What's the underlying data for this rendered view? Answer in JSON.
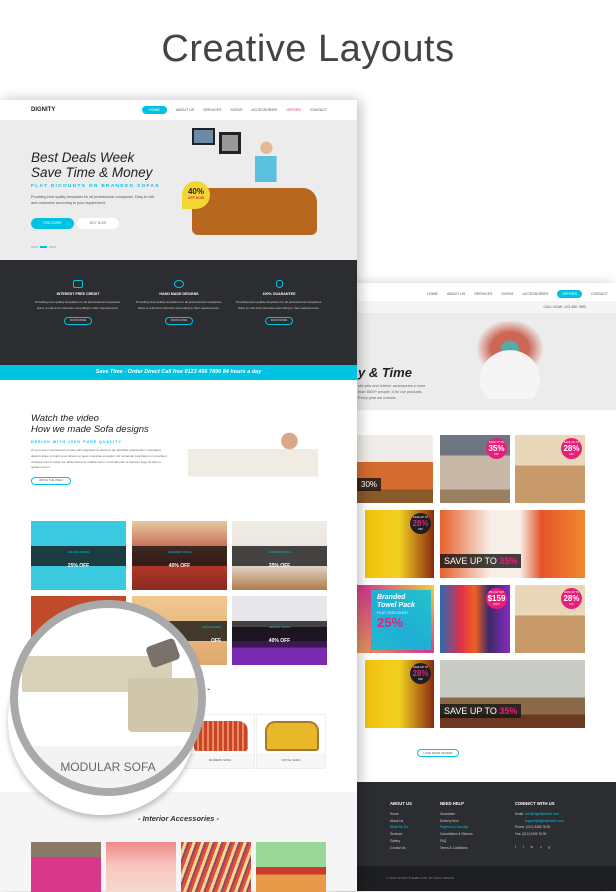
{
  "title": "Creative Layouts",
  "colors": {
    "accent": "#00c3e3",
    "pink": "#e91e7a",
    "dark": "#2b2d31"
  },
  "left_page": {
    "logo": "DIGNITY",
    "nav": [
      "HOME",
      "ABOUT US",
      "SERVICES",
      "SOFAS",
      "ACCESSORIES",
      "OFFERS",
      "CONTACT"
    ],
    "hero": {
      "title1": "Best Deals Week",
      "title2": "Save Time & Money",
      "subtitle": "FLAT DICOUNTS ON BRANDED SOFAS",
      "text": "Providing best quality templates for all professional companies. Easy to edit and customize according to your requirement.",
      "discover": "DISCOVER",
      "buy": "BUY NOW",
      "badge_pct": "40%",
      "badge_text": "OFF NOW"
    },
    "features": [
      {
        "icon": "credit-card-icon",
        "title": "INTEREST FREE CREDIT",
        "text": "Providing best quality templates for all professional companies. Easy to edit and customize according to their requirements.",
        "button": "KNOW MORE"
      },
      {
        "icon": "badge-icon",
        "title": "HAND MADE DESIGNS",
        "text": "Providing best quality templates for all professional companies. Easy to edit and customize according to their requirements.",
        "button": "KNOW MORE"
      },
      {
        "icon": "money-bag-icon",
        "title": "100% GUARANTEE",
        "text": "Providing best quality templates for all professional companies. Easy to edit and customize according to their requirements.",
        "button": "KNOW MORE"
      }
    ],
    "banner": "Save Time - Order Direct Call free 0123 456 7890 84 hours a day",
    "video": {
      "title1": "Watch the video",
      "title2": "How we made Sofa designs",
      "subtitle": "DESIGN WITH 100% PURE QUALITY",
      "text": "At vero eos et accusamus et iusto odio dignissimos ducimus qui blanditiis praesentium voluptatum deleniti atque corrupti quos dolores et quas molestias excepturi sint occaecati cupiditate non provident, similique sunt in culpa qui officia deserunt mollitia animi, id est laborum et dolorum fuga. Et harum quidem rerum.",
      "button": "WATCH THE VIDEO"
    },
    "grid": [
      {
        "name": "DELSON SOFAS",
        "off": "25% OFF"
      },
      {
        "name": "LEONARD SOFAS",
        "off": "40% OFF"
      },
      {
        "name": "LONDON SOFAS",
        "off": "35% OFF"
      },
      {
        "name": "",
        "off": ""
      },
      {
        "name": "DIVAN SOFAS",
        "off": "OFF"
      },
      {
        "name": "HEAVEN SOFAS",
        "off": "40% OFF"
      }
    ],
    "sofas_heading": "as -",
    "sofas": [
      "MODULAR SOFA",
      "",
      "MODERN SOFA",
      "ROYAL SOFA"
    ],
    "accessories_heading": "- Interior Accessories -"
  },
  "magnifier_label": "MODULAR SOFA",
  "right_page": {
    "nav": [
      "HOME",
      "ABOUT US",
      "SERVICES",
      "SOFAS",
      "ACCESSORIES",
      "OFFERS",
      "CONTACT"
    ],
    "call": "CALL NOW: 123 456 7890",
    "hero_title": "y & Time",
    "hero_text": "ofa sets and Interior accessories s more than 4500+ people. d for our products. Every year we roducts.",
    "tiles": {
      "t1": "30%",
      "b1": {
        "top": "SAVE UP TO",
        "pct": "35%",
        "bot": "OFF"
      },
      "b2": {
        "top": "SAVE UP TO",
        "pct": "28%",
        "bot": "OFF"
      },
      "b3": {
        "top": "SAVE UP TO",
        "pct": "28%",
        "bot": "OFF"
      },
      "save1": {
        "text": "SAVE UP TO",
        "pct": "35%"
      },
      "towel": {
        "title1": "Branded",
        "title2": "Towel Pack",
        "sub": "FLAT DISCOUNT",
        "pct": "25%"
      },
      "b4": {
        "top": "PILLOW SET",
        "pct": "$159",
        "bot": "ONLY"
      },
      "b5": {
        "top": "SAVE UP TO",
        "pct": "28%",
        "bot": "OFF"
      },
      "b6": {
        "top": "SAVE UP TO",
        "pct": "28%",
        "bot": "OFF"
      },
      "save2": {
        "text": "SAVE UP TO",
        "pct": "35%"
      }
    },
    "load_more": "LOAD MORE OFFERS",
    "footer": {
      "about_title": "ABOUT US",
      "about": [
        "Home",
        "About Us",
        "What We Do",
        "Services",
        "Gallery",
        "Contact Us"
      ],
      "help_title": "NEED HELP",
      "help": [
        "Guarantee",
        "Delivery Item",
        "Payment & Security",
        "Cancellation & Returns",
        "FAQ",
        "Terms & Conditions"
      ],
      "connect_title": "CONNECT WITH US",
      "email_label": "Email :",
      "email1": "info@dignitytheme.com",
      "email2": "support@dignitytheme.com",
      "phone": "Phone: (012) 3456 78 90",
      "fax": "Fax: (012) 3456 78 90",
      "social": [
        "f",
        "t",
        "in",
        "v",
        "g"
      ],
      "copyright": "© 2016 DIGNITYTHEME.COM, BY GOAL DESIGN"
    }
  }
}
